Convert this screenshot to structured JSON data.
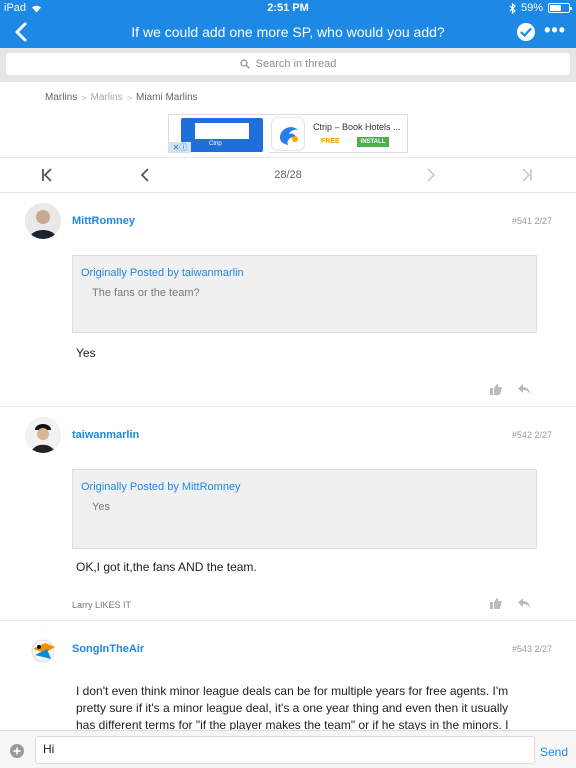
{
  "status_bar": {
    "device": "iPad",
    "time": "2:51 PM",
    "battery_text": "59%",
    "battery_level": 0.59
  },
  "nav": {
    "title": "If we could add one more SP, who would you add?"
  },
  "search": {
    "placeholder": "Search in thread"
  },
  "breadcrumb": [
    "Marlins",
    "Marlins",
    "Miami Marlins"
  ],
  "ad": {
    "title": "Ctrip – Book Hotels ...",
    "price": "FREE",
    "install": "INSTALL",
    "brand": "Ctrip"
  },
  "pager": {
    "page": "28/28"
  },
  "posts": [
    {
      "username": "MittRomney",
      "number": "#541",
      "date": "2/27",
      "quote": {
        "head": "Originally Posted by taiwanmarlin",
        "text": "The fans or the team?"
      },
      "body": "Yes"
    },
    {
      "username": "taiwanmarlin",
      "number": "#542",
      "date": "2/27",
      "quote": {
        "head": "Originally Posted by MittRomney",
        "text": "Yes"
      },
      "body": "OK,I got it,the fans AND the team.",
      "likes": "Larry LIKES IT"
    },
    {
      "username": "SongInTheAir",
      "number": "#543",
      "date": "2/27",
      "body": "I don't even think minor league deals can be for multiple years for free agents. I'm pretty sure if it's a minor league deal, it's a one year thing and even then it usually has different terms for \"if the player makes the team\" or if he stays in the minors. I think"
    }
  ],
  "reply": {
    "value": "Hi",
    "send": "Send"
  },
  "colors": {
    "accent": "#1e88e5"
  }
}
